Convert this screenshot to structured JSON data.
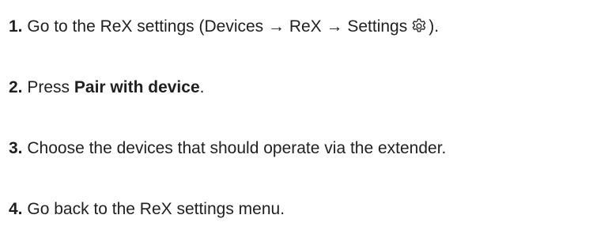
{
  "steps": [
    {
      "number": "1.",
      "text_before": "Go to the ReX settings (Devices → ReX → Settings",
      "icon": "gear-icon",
      "text_after": ")."
    },
    {
      "number": "2.",
      "text_before": "Press",
      "bold": "Pair with device",
      "text_after": "."
    },
    {
      "number": "3.",
      "text": "Choose the devices that should operate via the extender."
    },
    {
      "number": "4.",
      "text": "Go back to the ReX settings menu."
    }
  ]
}
